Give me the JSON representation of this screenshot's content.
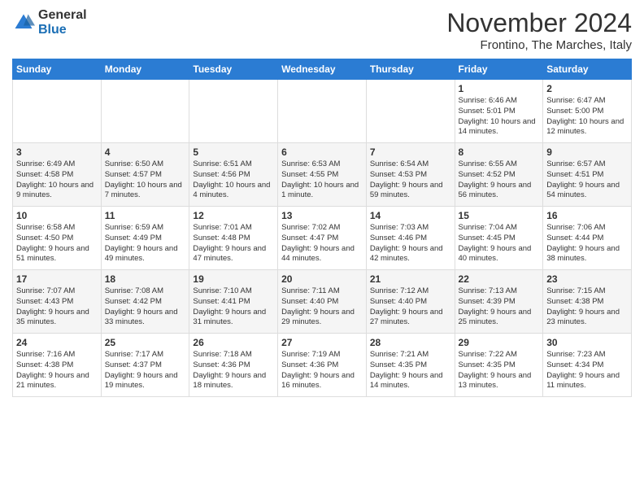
{
  "header": {
    "logo_general": "General",
    "logo_blue": "Blue",
    "month_title": "November 2024",
    "subtitle": "Frontino, The Marches, Italy"
  },
  "days_of_week": [
    "Sunday",
    "Monday",
    "Tuesday",
    "Wednesday",
    "Thursday",
    "Friday",
    "Saturday"
  ],
  "weeks": [
    [
      {
        "day": "",
        "info": ""
      },
      {
        "day": "",
        "info": ""
      },
      {
        "day": "",
        "info": ""
      },
      {
        "day": "",
        "info": ""
      },
      {
        "day": "",
        "info": ""
      },
      {
        "day": "1",
        "info": "Sunrise: 6:46 AM\nSunset: 5:01 PM\nDaylight: 10 hours and 14 minutes."
      },
      {
        "day": "2",
        "info": "Sunrise: 6:47 AM\nSunset: 5:00 PM\nDaylight: 10 hours and 12 minutes."
      }
    ],
    [
      {
        "day": "3",
        "info": "Sunrise: 6:49 AM\nSunset: 4:58 PM\nDaylight: 10 hours and 9 minutes."
      },
      {
        "day": "4",
        "info": "Sunrise: 6:50 AM\nSunset: 4:57 PM\nDaylight: 10 hours and 7 minutes."
      },
      {
        "day": "5",
        "info": "Sunrise: 6:51 AM\nSunset: 4:56 PM\nDaylight: 10 hours and 4 minutes."
      },
      {
        "day": "6",
        "info": "Sunrise: 6:53 AM\nSunset: 4:55 PM\nDaylight: 10 hours and 1 minute."
      },
      {
        "day": "7",
        "info": "Sunrise: 6:54 AM\nSunset: 4:53 PM\nDaylight: 9 hours and 59 minutes."
      },
      {
        "day": "8",
        "info": "Sunrise: 6:55 AM\nSunset: 4:52 PM\nDaylight: 9 hours and 56 minutes."
      },
      {
        "day": "9",
        "info": "Sunrise: 6:57 AM\nSunset: 4:51 PM\nDaylight: 9 hours and 54 minutes."
      }
    ],
    [
      {
        "day": "10",
        "info": "Sunrise: 6:58 AM\nSunset: 4:50 PM\nDaylight: 9 hours and 51 minutes."
      },
      {
        "day": "11",
        "info": "Sunrise: 6:59 AM\nSunset: 4:49 PM\nDaylight: 9 hours and 49 minutes."
      },
      {
        "day": "12",
        "info": "Sunrise: 7:01 AM\nSunset: 4:48 PM\nDaylight: 9 hours and 47 minutes."
      },
      {
        "day": "13",
        "info": "Sunrise: 7:02 AM\nSunset: 4:47 PM\nDaylight: 9 hours and 44 minutes."
      },
      {
        "day": "14",
        "info": "Sunrise: 7:03 AM\nSunset: 4:46 PM\nDaylight: 9 hours and 42 minutes."
      },
      {
        "day": "15",
        "info": "Sunrise: 7:04 AM\nSunset: 4:45 PM\nDaylight: 9 hours and 40 minutes."
      },
      {
        "day": "16",
        "info": "Sunrise: 7:06 AM\nSunset: 4:44 PM\nDaylight: 9 hours and 38 minutes."
      }
    ],
    [
      {
        "day": "17",
        "info": "Sunrise: 7:07 AM\nSunset: 4:43 PM\nDaylight: 9 hours and 35 minutes."
      },
      {
        "day": "18",
        "info": "Sunrise: 7:08 AM\nSunset: 4:42 PM\nDaylight: 9 hours and 33 minutes."
      },
      {
        "day": "19",
        "info": "Sunrise: 7:10 AM\nSunset: 4:41 PM\nDaylight: 9 hours and 31 minutes."
      },
      {
        "day": "20",
        "info": "Sunrise: 7:11 AM\nSunset: 4:40 PM\nDaylight: 9 hours and 29 minutes."
      },
      {
        "day": "21",
        "info": "Sunrise: 7:12 AM\nSunset: 4:40 PM\nDaylight: 9 hours and 27 minutes."
      },
      {
        "day": "22",
        "info": "Sunrise: 7:13 AM\nSunset: 4:39 PM\nDaylight: 9 hours and 25 minutes."
      },
      {
        "day": "23",
        "info": "Sunrise: 7:15 AM\nSunset: 4:38 PM\nDaylight: 9 hours and 23 minutes."
      }
    ],
    [
      {
        "day": "24",
        "info": "Sunrise: 7:16 AM\nSunset: 4:38 PM\nDaylight: 9 hours and 21 minutes."
      },
      {
        "day": "25",
        "info": "Sunrise: 7:17 AM\nSunset: 4:37 PM\nDaylight: 9 hours and 19 minutes."
      },
      {
        "day": "26",
        "info": "Sunrise: 7:18 AM\nSunset: 4:36 PM\nDaylight: 9 hours and 18 minutes."
      },
      {
        "day": "27",
        "info": "Sunrise: 7:19 AM\nSunset: 4:36 PM\nDaylight: 9 hours and 16 minutes."
      },
      {
        "day": "28",
        "info": "Sunrise: 7:21 AM\nSunset: 4:35 PM\nDaylight: 9 hours and 14 minutes."
      },
      {
        "day": "29",
        "info": "Sunrise: 7:22 AM\nSunset: 4:35 PM\nDaylight: 9 hours and 13 minutes."
      },
      {
        "day": "30",
        "info": "Sunrise: 7:23 AM\nSunset: 4:34 PM\nDaylight: 9 hours and 11 minutes."
      }
    ]
  ]
}
